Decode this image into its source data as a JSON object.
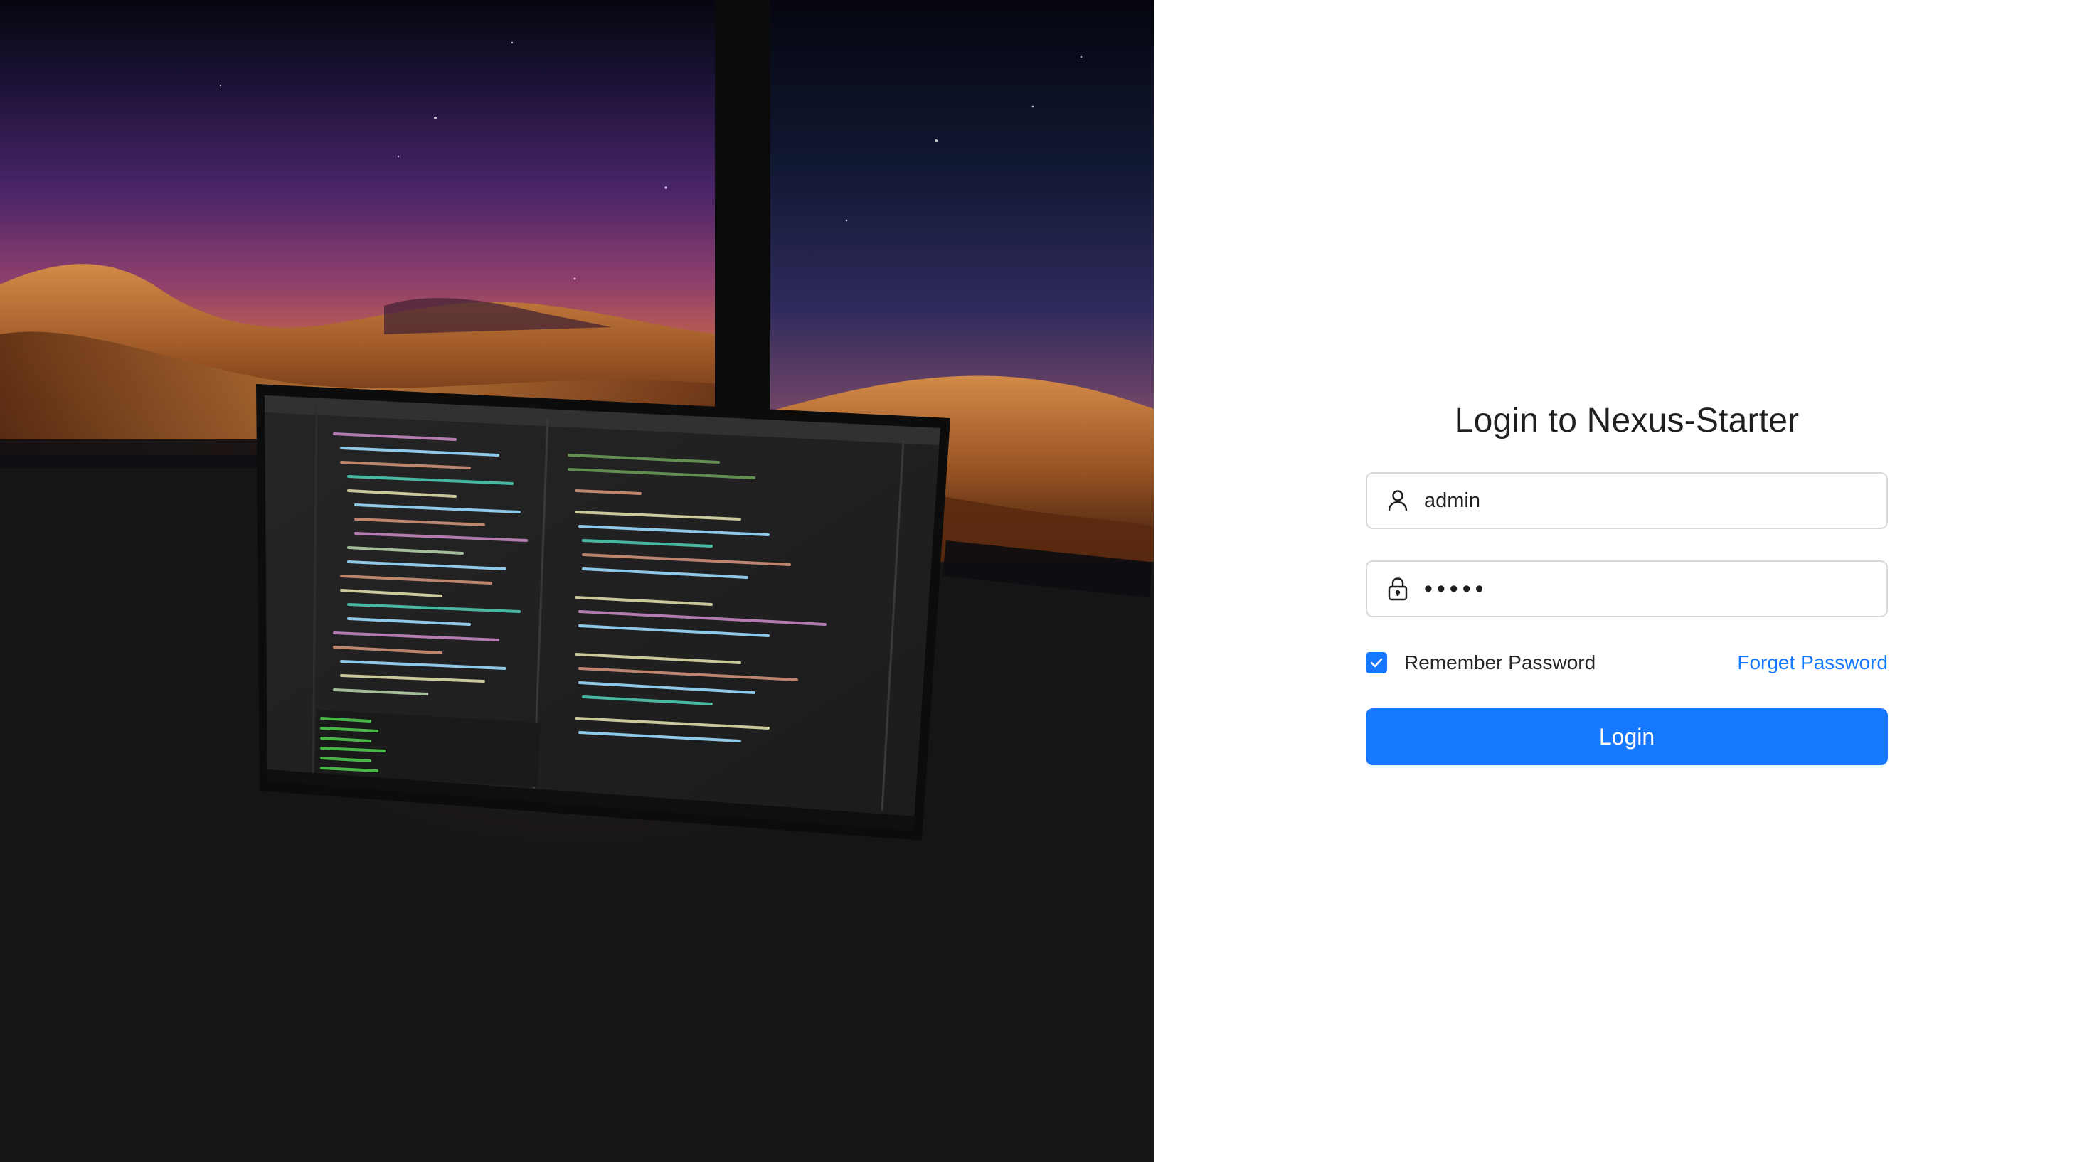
{
  "hero": {
    "image_description_icon": "desk-setup-photo"
  },
  "login": {
    "title": "Login to Nexus-Starter",
    "username": {
      "value": "admin",
      "icon": "user-icon"
    },
    "password": {
      "value": "12345",
      "icon": "lock-icon"
    },
    "remember_label": "Remember Password",
    "remember_checked": true,
    "forget_label": "Forget Password",
    "submit_label": "Login"
  },
  "colors": {
    "accent": "#1677ff",
    "border": "#d9d9d9",
    "title": "#1f1f1f"
  }
}
